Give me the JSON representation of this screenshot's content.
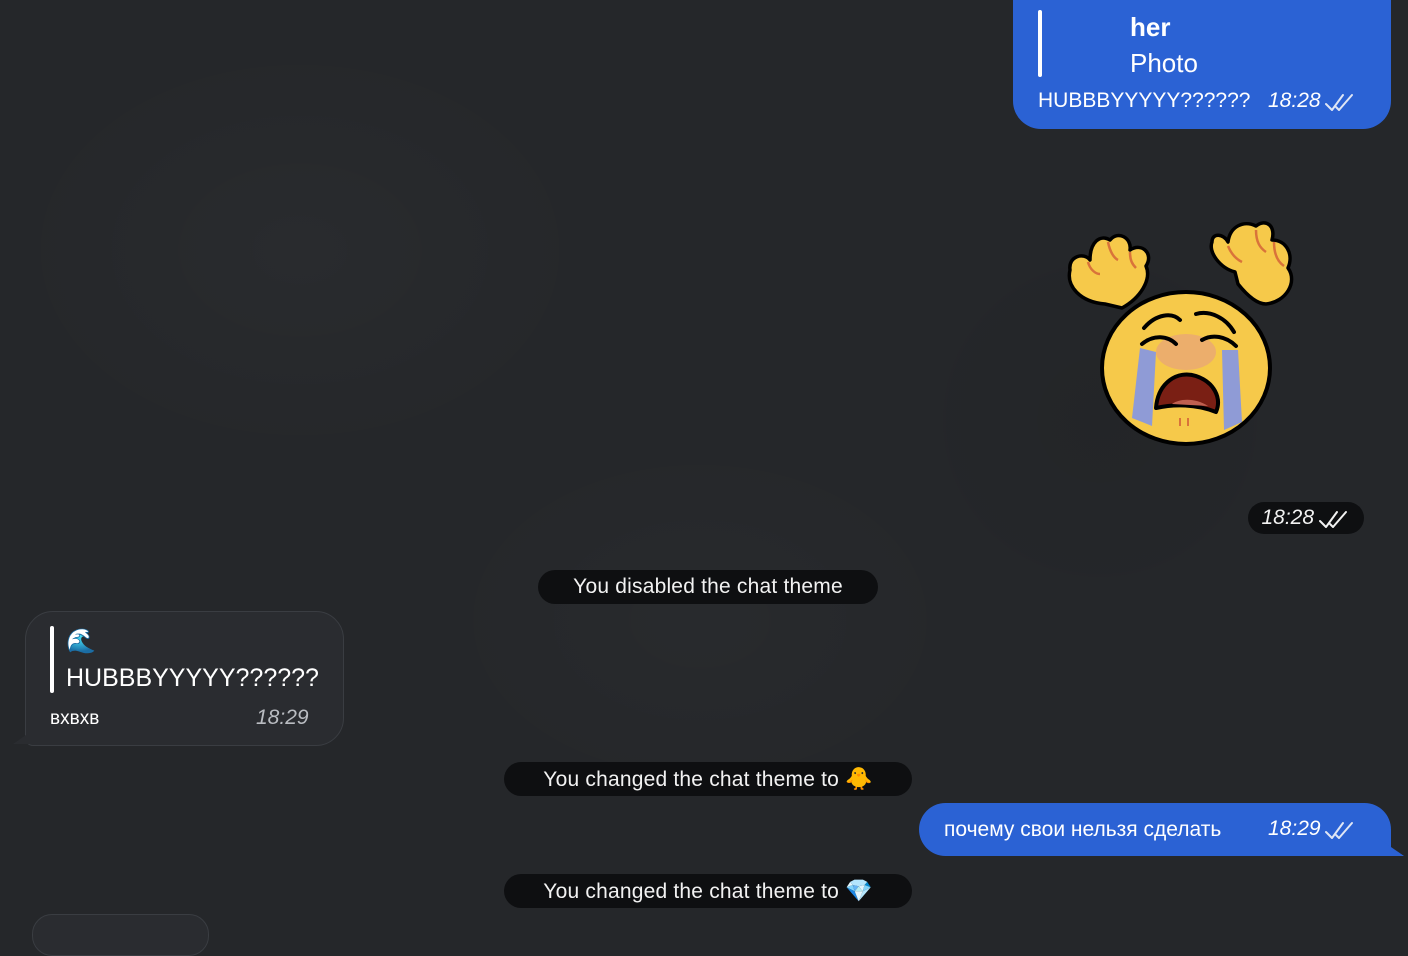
{
  "messages": {
    "top_reply": {
      "reply_name": "her",
      "reply_text": "Photo",
      "text": "HUBBBYYYYY??????",
      "time": "18:28"
    },
    "sticker": {
      "sticker_name": "crying-face-sticker",
      "time": "18:28"
    },
    "service_1": "You disabled the chat theme",
    "incoming": {
      "reply_emoji": "🌊",
      "reply_text": "HUBBBYYYYY??????",
      "text": "вхвхв",
      "time": "18:29"
    },
    "service_2": {
      "text": "You changed the chat theme to",
      "emoji": "🐥"
    },
    "outgoing_2": {
      "text": "почему свои нельзя сделать",
      "time": "18:29"
    },
    "service_3": {
      "text": "You changed the chat theme to",
      "emoji": "💎"
    }
  },
  "colors": {
    "background": "#25272a",
    "outgoing_bubble": "#2b62d4",
    "incoming_bubble": "#2a2c30",
    "service_pill": "#0c0d0f"
  },
  "icons": [
    "double-check-icon",
    "crying-face-sticker"
  ]
}
